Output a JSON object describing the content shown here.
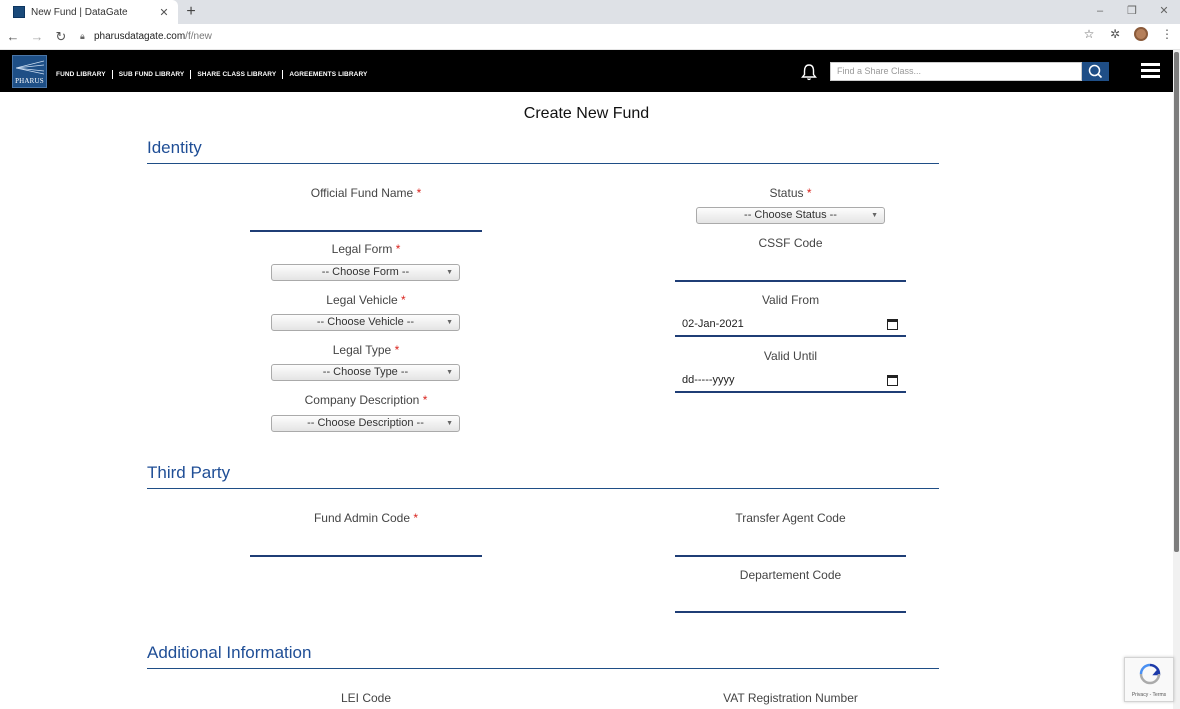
{
  "browser": {
    "tab_title": "New Fund | DataGate",
    "new_tab": "+",
    "url_domain": "pharusdatagate.com",
    "url_path": "/f/new",
    "window_controls": [
      "–",
      "❒",
      "✕"
    ]
  },
  "header": {
    "logo_text": "PHARUS",
    "nav": [
      "FUND LIBRARY",
      "SUB FUND LIBRARY",
      "SHARE CLASS LIBRARY",
      "AGREEMENTS LIBRARY"
    ],
    "search_placeholder": "Find a Share Class..."
  },
  "page": {
    "title": "Create New Fund",
    "required_mark": "*"
  },
  "sections": {
    "identity": "Identity",
    "third_party": "Third Party",
    "additional": "Additional Information"
  },
  "identity": {
    "official_fund_name": "Official Fund Name",
    "legal_form": "Legal Form",
    "legal_form_value": "-- Choose Form --",
    "legal_vehicle": "Legal Vehicle",
    "legal_vehicle_value": "-- Choose Vehicle --",
    "legal_type": "Legal Type",
    "legal_type_value": "-- Choose Type --",
    "company_description": "Company Description",
    "company_description_value": "-- Choose Description --",
    "status": "Status",
    "status_value": "-- Choose Status --",
    "cssf_code": "CSSF Code",
    "valid_from": "Valid From",
    "valid_from_value": "02-Jan-2021",
    "valid_until": "Valid Until",
    "valid_until_value": "dd-----yyyy"
  },
  "third_party": {
    "fund_admin_code": "Fund Admin Code",
    "transfer_agent_code": "Transfer Agent Code",
    "departement_code": "Departement Code"
  },
  "additional": {
    "lei_code": "LEI Code",
    "vat_registration": "VAT Registration Number"
  },
  "recaptcha": {
    "text": "Privacy - Terms"
  }
}
